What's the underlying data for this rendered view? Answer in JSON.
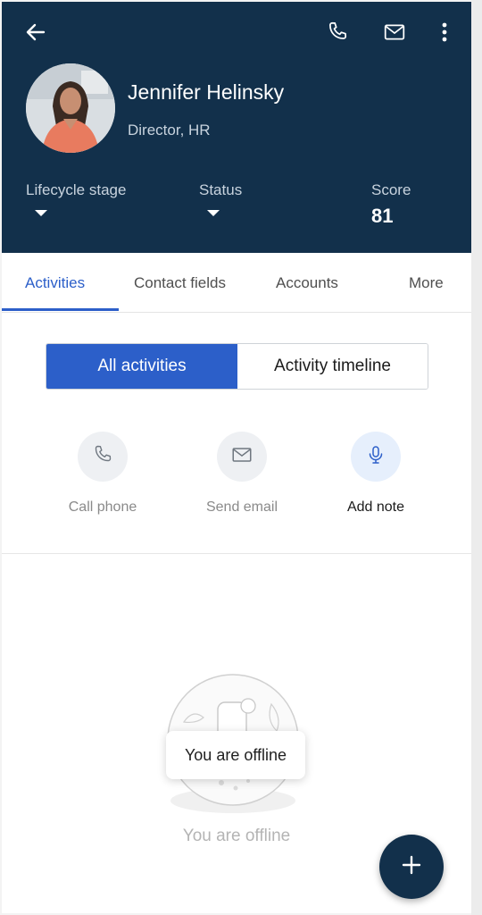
{
  "contact": {
    "name": "Jennifer Helinsky",
    "title": "Director, HR"
  },
  "stats": {
    "lifecycle_label": "Lifecycle stage",
    "status_label": "Status",
    "score_label": "Score",
    "score_value": "81"
  },
  "tabs": [
    {
      "label": "Activities",
      "active": true
    },
    {
      "label": "Contact fields"
    },
    {
      "label": "Accounts"
    },
    {
      "label": "More"
    }
  ],
  "segment": {
    "all_label": "All activities",
    "timeline_label": "Activity timeline"
  },
  "actions": [
    {
      "label": "Call phone",
      "icon": "phone-icon"
    },
    {
      "label": "Send email",
      "icon": "mail-icon"
    },
    {
      "label": "Add note",
      "icon": "mic-icon"
    }
  ],
  "empty_state": {
    "text": "You are offline"
  },
  "toast": {
    "text": "You are offline"
  },
  "colors": {
    "header_bg": "#12304b",
    "accent": "#2c5fc9"
  }
}
